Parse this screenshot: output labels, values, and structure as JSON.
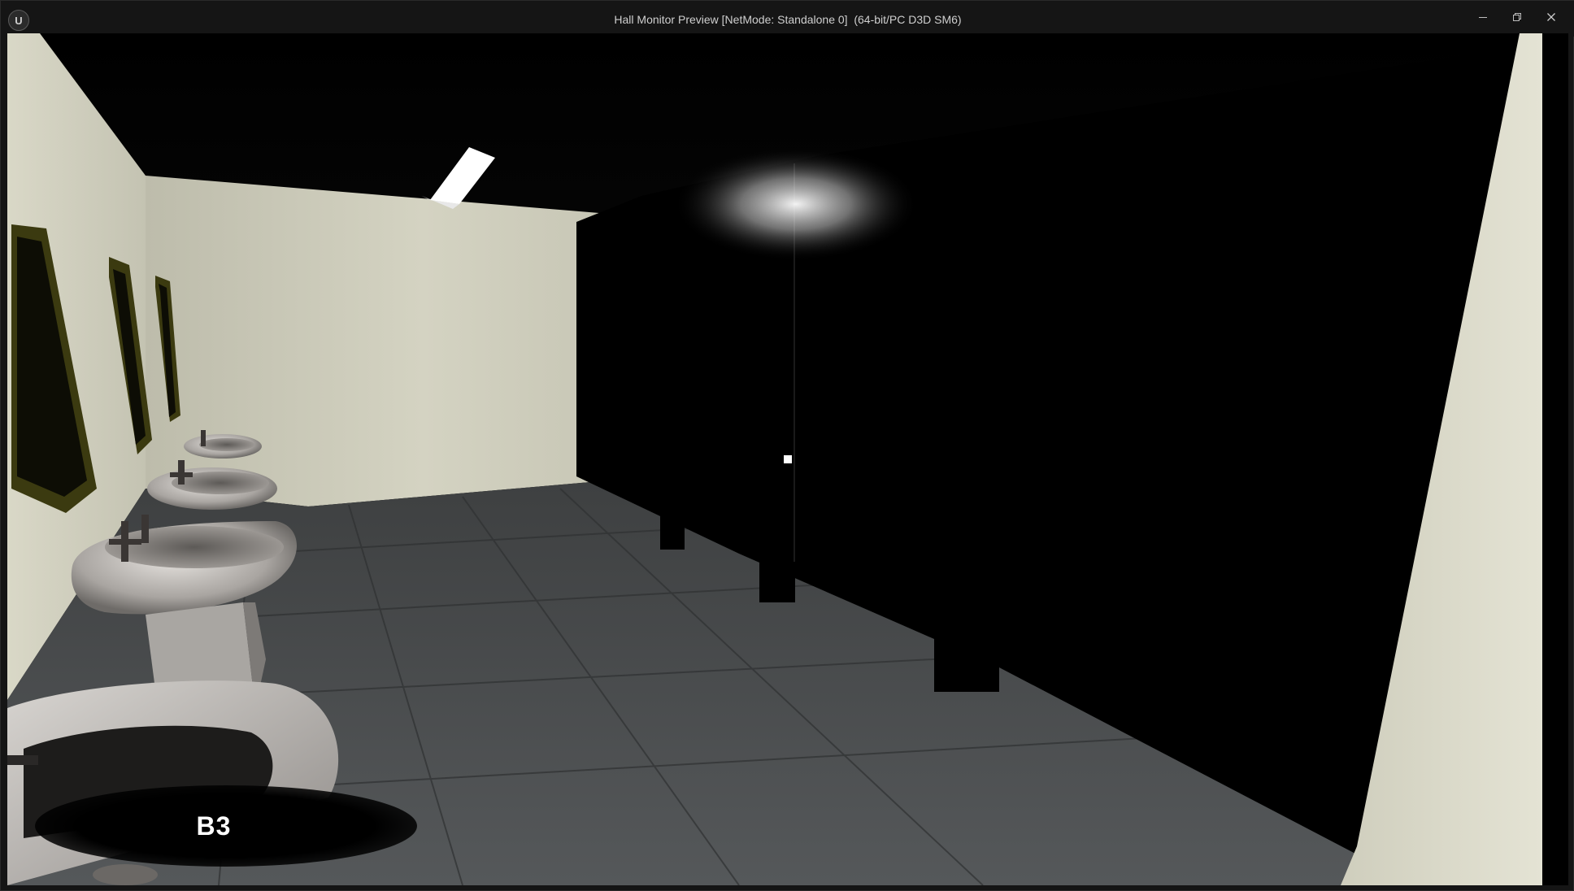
{
  "window": {
    "title": "Hall Monitor Preview [NetMode: Standalone 0]  (64-bit/PC D3D SM6)",
    "logo_glyph": "U",
    "buttons": [
      {
        "name": "minimize",
        "icon": "minimize-icon"
      },
      {
        "name": "restore",
        "icon": "restore-icon"
      },
      {
        "name": "close",
        "icon": "close-icon"
      }
    ]
  },
  "hud": {
    "floor_label": "B3",
    "crosshair": "crosshair-dot"
  },
  "colors": {
    "titlebar": "#151515",
    "title_text": "#cfcfcf",
    "wall": "#d2d1bf",
    "floor": "#4a4c4d",
    "stalls": "#000000",
    "hud_text": "#ffffff"
  }
}
